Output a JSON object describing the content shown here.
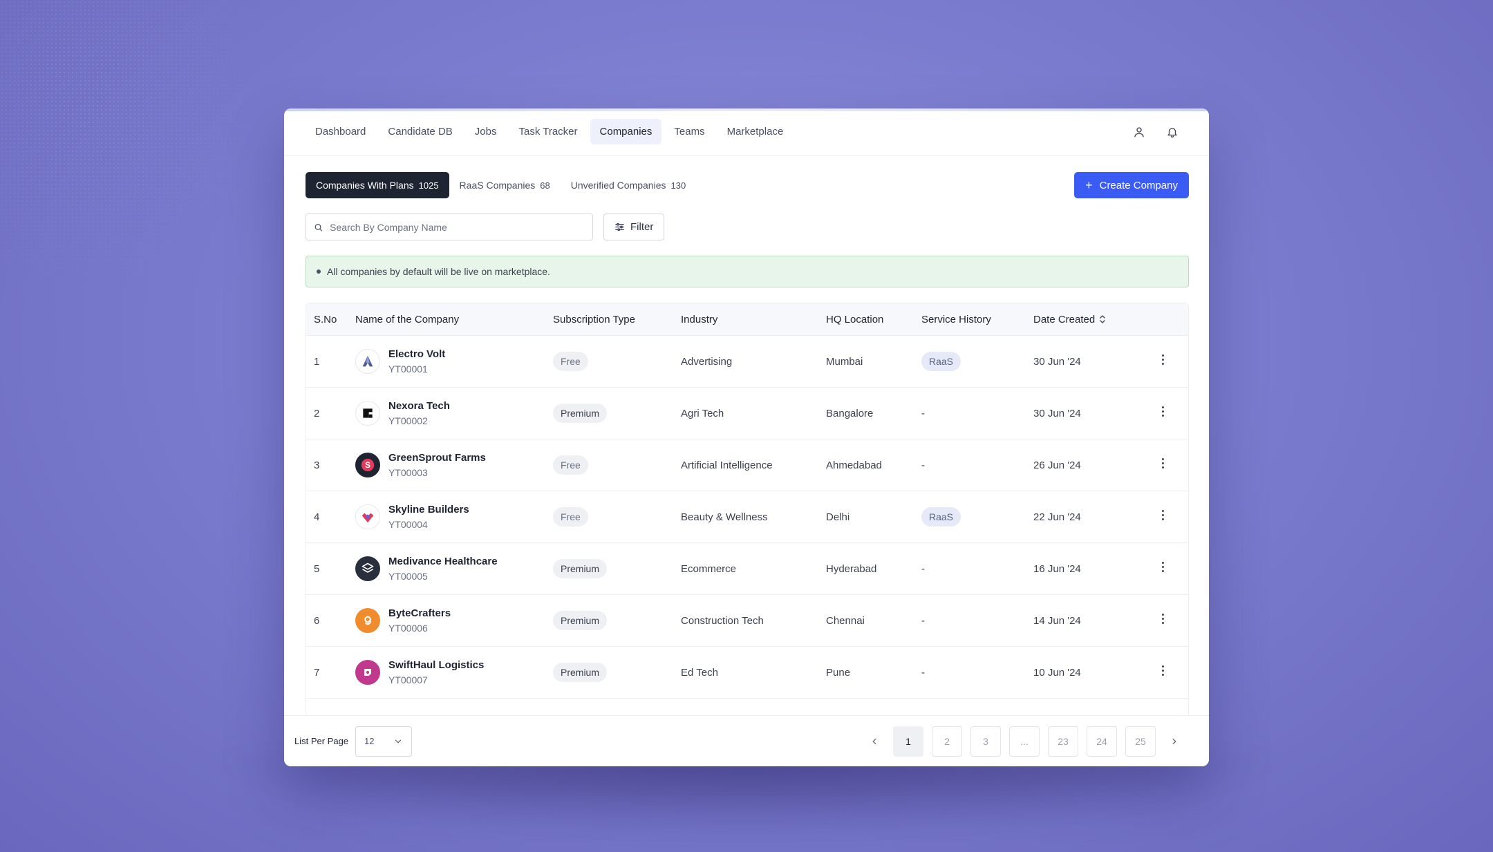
{
  "nav": {
    "tabs": [
      "Dashboard",
      "Candidate DB",
      "Jobs",
      "Task Tracker",
      "Companies",
      "Teams",
      "Marketplace"
    ],
    "active": "Companies",
    "icons": [
      "user-icon",
      "bell-icon"
    ]
  },
  "segments": [
    {
      "label": "Companies With Plans",
      "count": "1025"
    },
    {
      "label": "RaaS Companies",
      "count": "68"
    },
    {
      "label": "Unverified Companies",
      "count": "130"
    }
  ],
  "create_button": "Create Company",
  "search": {
    "placeholder": "Search By Company Name",
    "value": ""
  },
  "filter_label": "Filter",
  "notice": "All companies by default will be live on marketplace.",
  "table": {
    "headers": [
      "S.No",
      "Name of the Company",
      "Subscription Type",
      "Industry",
      "HQ Location",
      "Service History",
      "Date Created"
    ],
    "rows": [
      {
        "sno": "1",
        "name": "Electro Volt",
        "id": "YT00001",
        "sub": "Free",
        "industry": "Advertising",
        "hq": "Mumbai",
        "svc": "RaaS",
        "date": "30 Jun '24"
      },
      {
        "sno": "2",
        "name": "Nexora Tech",
        "id": "YT00002",
        "sub": "Premium",
        "industry": "Agri Tech",
        "hq": "Bangalore",
        "svc": "-",
        "date": "30 Jun '24"
      },
      {
        "sno": "3",
        "name": "GreenSprout Farms",
        "id": "YT00003",
        "sub": "Free",
        "industry": "Artificial Intelligence",
        "hq": "Ahmedabad",
        "svc": "-",
        "date": "26 Jun '24"
      },
      {
        "sno": "4",
        "name": "Skyline Builders",
        "id": "YT00004",
        "sub": "Free",
        "industry": "Beauty & Wellness",
        "hq": "Delhi",
        "svc": "RaaS",
        "date": "22 Jun '24"
      },
      {
        "sno": "5",
        "name": "Medivance Healthcare",
        "id": "YT00005",
        "sub": "Premium",
        "industry": "Ecommerce",
        "hq": "Hyderabad",
        "svc": "-",
        "date": "16 Jun '24"
      },
      {
        "sno": "6",
        "name": "ByteCrafters",
        "id": "YT00006",
        "sub": "Premium",
        "industry": "Construction Tech",
        "hq": "Chennai",
        "svc": "-",
        "date": "14 Jun '24"
      },
      {
        "sno": "7",
        "name": "SwiftHaul Logistics",
        "id": "YT00007",
        "sub": "Premium",
        "industry": "Ed Tech",
        "hq": "Pune",
        "svc": "-",
        "date": "10 Jun '24"
      }
    ]
  },
  "footer": {
    "list_per_page_label": "List Per Page",
    "list_per_page_value": "12",
    "pages": [
      "1",
      "2",
      "3",
      "...",
      "23",
      "24",
      "25"
    ],
    "active_page": "1"
  },
  "colors": {
    "accent": "#3b5bf5",
    "dark": "#1f2433",
    "notice_bg": "#e8f5ea"
  }
}
